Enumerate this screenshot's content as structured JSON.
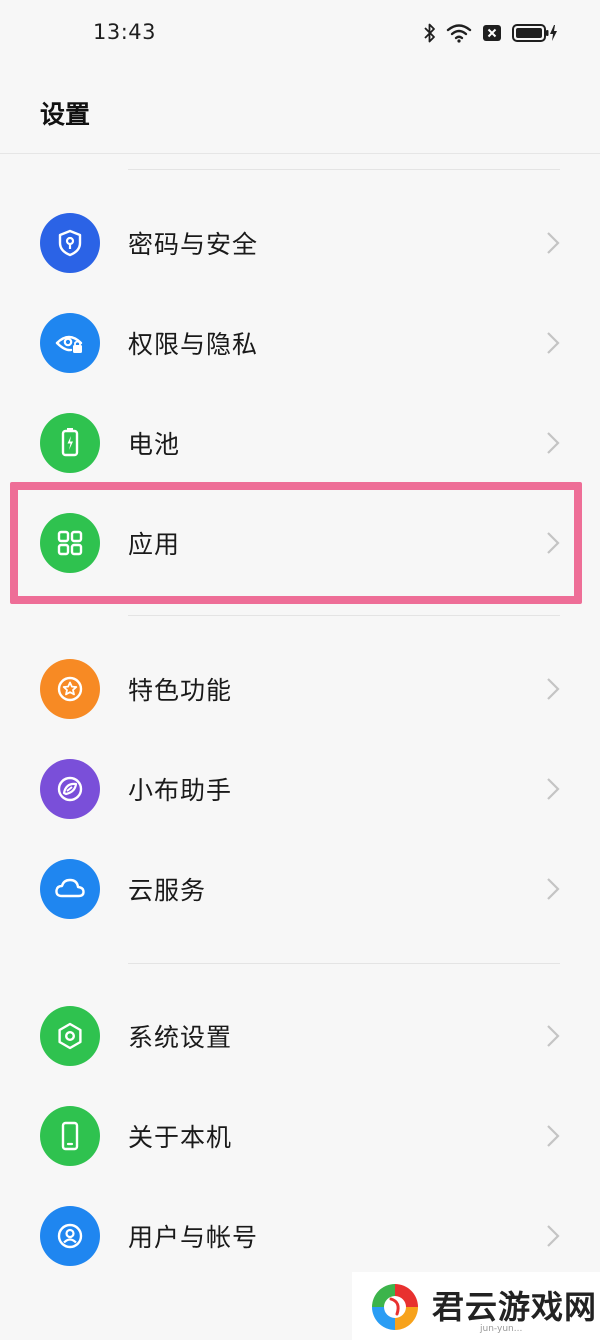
{
  "status_bar": {
    "time": "13:43",
    "icons": [
      "bluetooth-icon",
      "wifi-icon",
      "no-sim-icon",
      "battery-charging-icon"
    ]
  },
  "header": {
    "title": "设置"
  },
  "settings": [
    {
      "label": "密码与安全",
      "icon": "shield-key-icon",
      "color": "#2b63e6"
    },
    {
      "label": "权限与隐私",
      "icon": "eye-lock-icon",
      "color": "#1f86f0"
    },
    {
      "label": "电池",
      "icon": "battery-icon",
      "color": "#2fc24f"
    },
    {
      "label": "应用",
      "icon": "grid-apps-icon",
      "color": "#2fc24f"
    },
    {
      "label": "特色功能",
      "icon": "star-circle-icon",
      "color": "#f78a24"
    },
    {
      "label": "小布助手",
      "icon": "assistant-icon",
      "color": "#7a4fd9"
    },
    {
      "label": "云服务",
      "icon": "cloud-icon",
      "color": "#1f86f0"
    },
    {
      "label": "系统设置",
      "icon": "hexagon-gear-icon",
      "color": "#2fc24f"
    },
    {
      "label": "关于本机",
      "icon": "phone-icon",
      "color": "#2fc24f"
    },
    {
      "label": "用户与帐号",
      "icon": "user-circle-icon",
      "color": "#1f86f0"
    }
  ],
  "highlight_color": "#ee6e97",
  "watermark": {
    "text": "君云游戏网",
    "sub": "jun-yun..."
  }
}
